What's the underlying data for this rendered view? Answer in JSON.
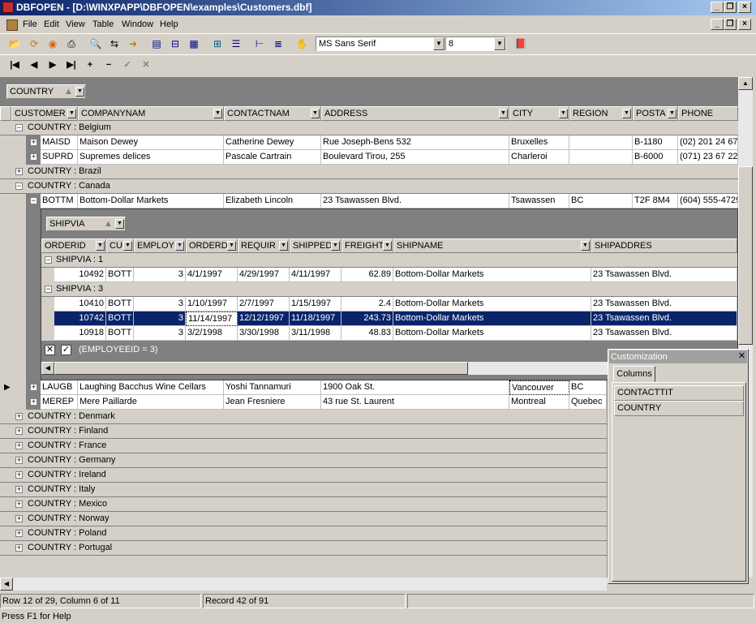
{
  "window": {
    "title": "DBFOPEN - [D:\\WINXPAPP\\DBFOPEN\\examples\\Customers.dbf]"
  },
  "menu": [
    "File",
    "Edit",
    "View",
    "Table",
    "Window",
    "Help"
  ],
  "toolbar": {
    "font": "MS Sans Serif",
    "size": "8"
  },
  "group_panel": {
    "label": "COUNTRY"
  },
  "columns": [
    "CUSTOMER",
    "COMPANYNAM",
    "CONTACTNAM",
    "ADDRESS",
    "CITY",
    "REGION",
    "POSTA",
    "PHONE"
  ],
  "groups": {
    "belgium": "COUNTRY : Belgium",
    "brazil": "COUNTRY : Brazil",
    "canada": "COUNTRY : Canada",
    "rest": [
      "COUNTRY : Denmark",
      "COUNTRY : Finland",
      "COUNTRY : France",
      "COUNTRY : Germany",
      "COUNTRY : Ireland",
      "COUNTRY : Italy",
      "COUNTRY : Mexico",
      "COUNTRY : Norway",
      "COUNTRY : Poland",
      "COUNTRY : Portugal"
    ]
  },
  "rows": {
    "maisd": [
      "MAISD",
      "Maison Dewey",
      "Catherine Dewey",
      "Rue Joseph-Bens 532",
      "Bruxelles",
      "",
      "B-1180",
      "(02) 201 24 67"
    ],
    "suprd": [
      "SUPRD",
      "Supremes delices",
      "Pascale Cartrain",
      "Boulevard Tirou, 255",
      "Charleroi",
      "",
      "B-6000",
      "(071) 23 67 22"
    ],
    "bottm": [
      "BOTTM",
      "Bottom-Dollar Markets",
      "Elizabeth Lincoln",
      "23 Tsawassen Blvd.",
      "Tsawassen",
      "BC",
      "T2F 8M4",
      "(604) 555-4729"
    ],
    "laugb": [
      "LAUGB",
      "Laughing Bacchus Wine Cellars",
      "Yoshi Tannamuri",
      "1900 Oak St.",
      "Vancouver",
      "BC",
      "",
      ""
    ],
    "merep": [
      "MEREP",
      "Mere Paillarde",
      "Jean Fresniere",
      "43 rue St. Laurent",
      "Montreal",
      "Quebec",
      "",
      ""
    ]
  },
  "detail": {
    "group_panel": "SHIPVIA",
    "columns": [
      "ORDERID",
      "CU",
      "EMPLOY",
      "ORDERD",
      "REQUIR",
      "SHIPPED",
      "FREIGHT",
      "SHIPNAME",
      "SHIPADDRES"
    ],
    "group1": "SHIPVIA : 1",
    "group3": "SHIPVIA : 3",
    "r1": [
      "10492",
      "BOTT",
      "3",
      "4/1/1997",
      "4/29/1997",
      "4/11/1997",
      "62.89",
      "Bottom-Dollar Markets",
      "23 Tsawassen Blvd."
    ],
    "r2": [
      "10410",
      "BOTT",
      "3",
      "1/10/1997",
      "2/7/1997",
      "1/15/1997",
      "2.4",
      "Bottom-Dollar Markets",
      "23 Tsawassen Blvd."
    ],
    "r3": [
      "10742",
      "BOTT",
      "3",
      "11/14/1997",
      "12/12/1997",
      "11/18/1997",
      "243.73",
      "Bottom-Dollar Markets",
      "23 Tsawassen Blvd."
    ],
    "r4": [
      "10918",
      "BOTT",
      "3",
      "3/2/1998",
      "3/30/1998",
      "3/11/1998",
      "48.83",
      "Bottom-Dollar Markets",
      "23 Tsawassen Blvd."
    ],
    "filter": "(EMPLOYEEID = 3)"
  },
  "customization": {
    "title": "Customization",
    "tab": "Columns",
    "items": [
      "CONTACTTIT",
      "COUNTRY"
    ]
  },
  "status": {
    "position": "Row 12 of 29, Column 6 of 11",
    "record": "Record 42 of 91",
    "help": "Press F1 for Help"
  }
}
